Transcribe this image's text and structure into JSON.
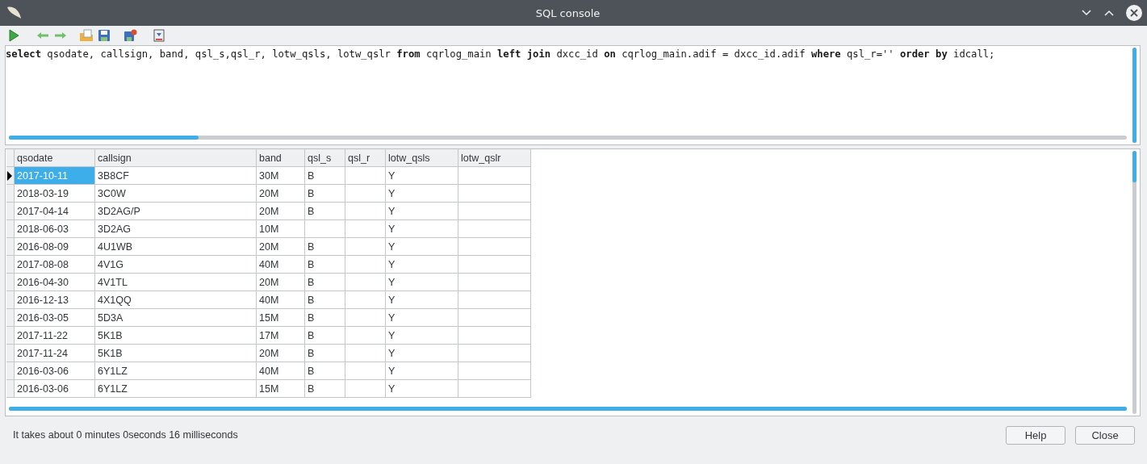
{
  "window": {
    "title": "SQL console"
  },
  "query": "**select** qsodate, callsign, band, qsl_s,qsl_r, lotw_qsls, lotw_qslr **from** cqrlog_main **left join** dxcc_id **on** cqrlog_main.adif = dxcc_id.adif **where** qsl_r='' **order by** idcall;",
  "table": {
    "columns": [
      "qsodate",
      "callsign",
      "band",
      "qsl_s",
      "qsl_r",
      "lotw_qsls",
      "lotw_qslr"
    ],
    "rows": [
      {
        "selected": true,
        "cells": [
          "2017-10-11",
          "3B8CF",
          "30M",
          "B",
          "",
          "Y",
          ""
        ]
      },
      {
        "selected": false,
        "cells": [
          "2018-03-19",
          "3C0W",
          "20M",
          "B",
          "",
          "Y",
          ""
        ]
      },
      {
        "selected": false,
        "cells": [
          "2017-04-14",
          "3D2AG/P",
          "20M",
          "B",
          "",
          "Y",
          ""
        ]
      },
      {
        "selected": false,
        "cells": [
          "2018-06-03",
          "3D2AG",
          "10M",
          "",
          "",
          "Y",
          ""
        ]
      },
      {
        "selected": false,
        "cells": [
          "2016-08-09",
          "4U1WB",
          "20M",
          "B",
          "",
          "Y",
          ""
        ]
      },
      {
        "selected": false,
        "cells": [
          "2017-08-08",
          "4V1G",
          "40M",
          "B",
          "",
          "Y",
          ""
        ]
      },
      {
        "selected": false,
        "cells": [
          "2016-04-30",
          "4V1TL",
          "20M",
          "B",
          "",
          "Y",
          ""
        ]
      },
      {
        "selected": false,
        "cells": [
          "2016-12-13",
          "4X1QQ",
          "40M",
          "B",
          "",
          "Y",
          ""
        ]
      },
      {
        "selected": false,
        "cells": [
          "2016-03-05",
          "5D3A",
          "15M",
          "B",
          "",
          "Y",
          ""
        ]
      },
      {
        "selected": false,
        "cells": [
          "2017-11-22",
          "5K1B",
          "17M",
          "B",
          "",
          "Y",
          ""
        ]
      },
      {
        "selected": false,
        "cells": [
          "2017-11-24",
          "5K1B",
          "20M",
          "B",
          "",
          "Y",
          ""
        ]
      },
      {
        "selected": false,
        "cells": [
          "2016-03-06",
          "6Y1LZ",
          "40M",
          "B",
          "",
          "Y",
          ""
        ]
      },
      {
        "selected": false,
        "cells": [
          "2016-03-06",
          "6Y1LZ",
          "15M",
          "B",
          "",
          "Y",
          ""
        ]
      }
    ]
  },
  "status": "It takes about 0 minutes 0seconds 16 milliseconds",
  "buttons": [
    "Help",
    "Close"
  ]
}
